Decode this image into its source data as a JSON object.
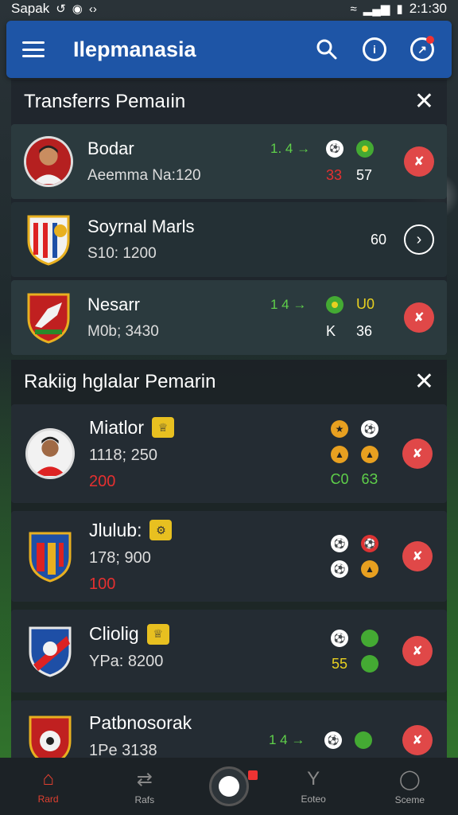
{
  "status_bar": {
    "carrier": "Sapak",
    "time": "2:1:30"
  },
  "app_bar": {
    "title": "Ilepmanasia"
  },
  "transfers": {
    "title": "Transferrs Pemaıin",
    "rows": [
      {
        "name": "Bodar",
        "sub": "Aeemma Na:120",
        "trend": "1. 4",
        "v1": "33",
        "v2": "57",
        "action": "remove"
      },
      {
        "name": "Soyrnal Marls",
        "sub": "S10: 1200",
        "v2": "60",
        "action": "next"
      },
      {
        "name": "Nesarr",
        "sub": "M0b; 3430",
        "trend": "1 4",
        "v1": "U0",
        "v1b": "K",
        "v2": "36",
        "action": "remove"
      }
    ]
  },
  "ranking": {
    "title": "Rakiig hglalar Pemarin",
    "rows": [
      {
        "name": "Miatlor",
        "sub": "1118; 250",
        "score": "200",
        "s1": "C0",
        "s2": "6З"
      },
      {
        "name": "Jlulub:",
        "sub": "178; 900",
        "score": "100"
      },
      {
        "name": "Cliolig",
        "sub": "YPa: 8200",
        "s1": "55"
      },
      {
        "name": "Patbnosorak",
        "sub": "1Pe 3138",
        "trend": "1 4"
      }
    ]
  },
  "bottom_nav": {
    "items": [
      {
        "label": "Rard",
        "icon": "home-icon"
      },
      {
        "label": "Rafs",
        "icon": "transfers-icon"
      },
      {
        "label": "Eoteo",
        "icon": "trophy-icon"
      },
      {
        "label": "Sceme",
        "icon": "profile-icon"
      }
    ]
  }
}
